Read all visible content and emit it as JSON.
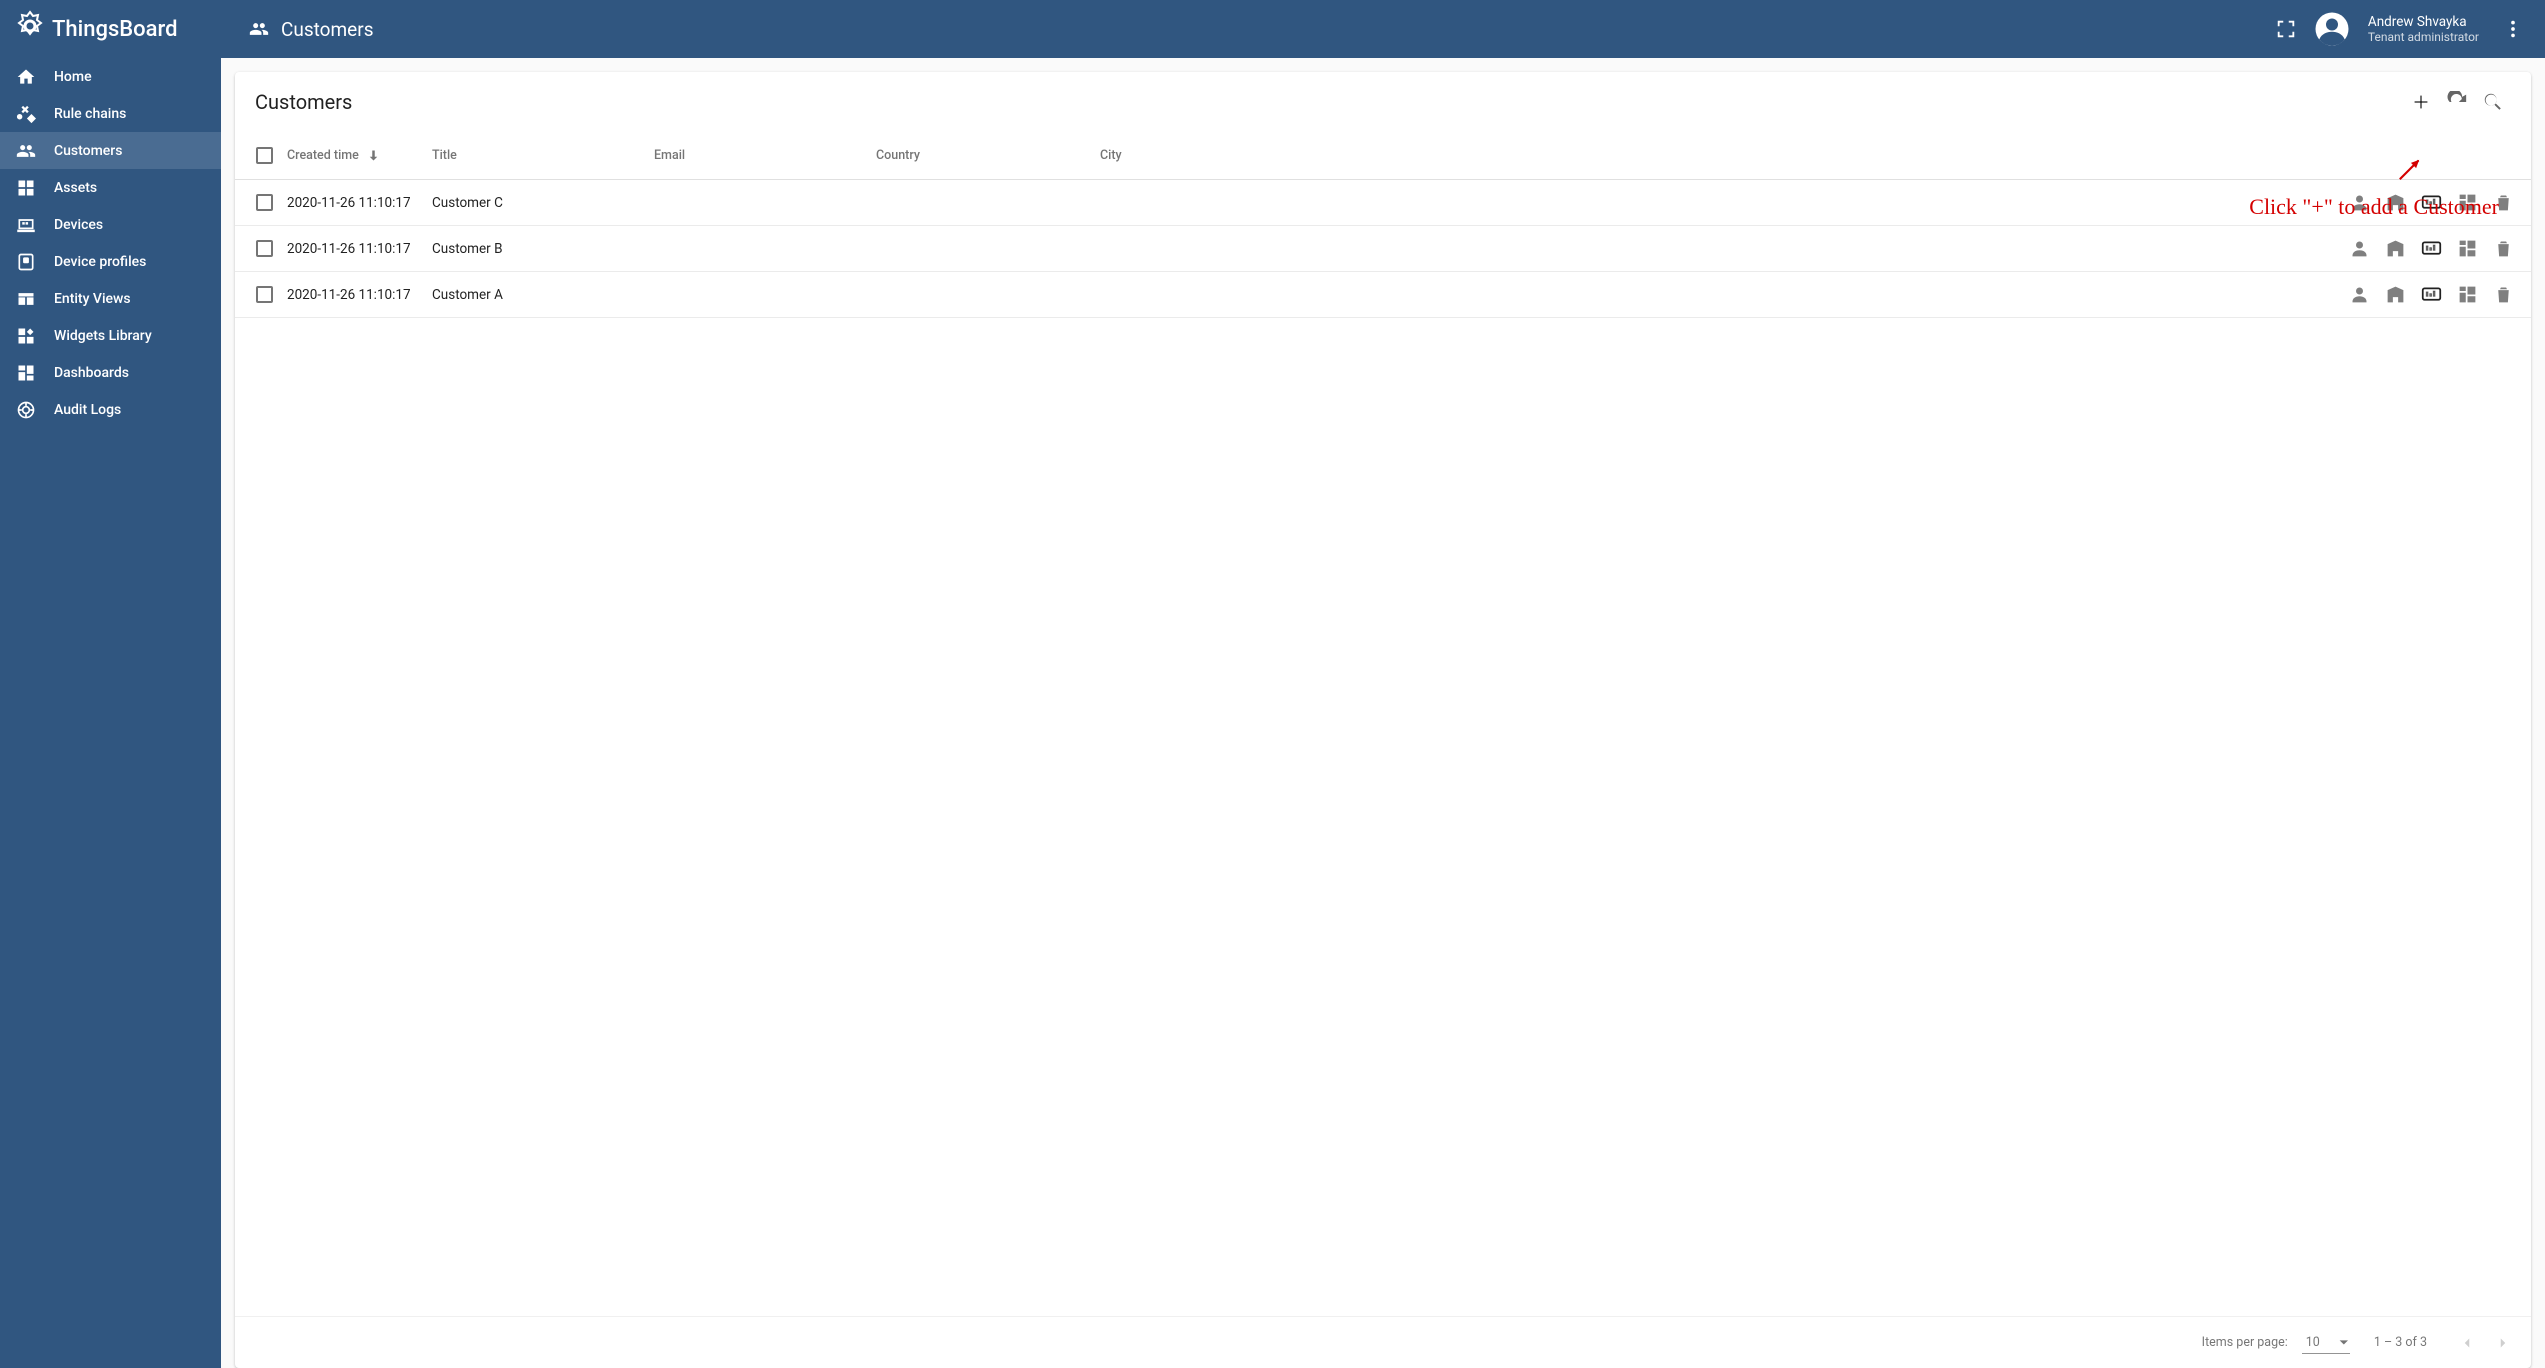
{
  "brand": {
    "name": "ThingsBoard"
  },
  "header": {
    "title": "Customers",
    "user_name": "Andrew Shvayka",
    "user_role": "Tenant administrator"
  },
  "sidebar": {
    "items": [
      {
        "label": "Home",
        "icon": "home-icon"
      },
      {
        "label": "Rule chains",
        "icon": "rule-chains-icon"
      },
      {
        "label": "Customers",
        "icon": "customers-icon",
        "active": true
      },
      {
        "label": "Assets",
        "icon": "assets-icon"
      },
      {
        "label": "Devices",
        "icon": "devices-icon"
      },
      {
        "label": "Device profiles",
        "icon": "device-profiles-icon"
      },
      {
        "label": "Entity Views",
        "icon": "entity-views-icon"
      },
      {
        "label": "Widgets Library",
        "icon": "widgets-library-icon"
      },
      {
        "label": "Dashboards",
        "icon": "dashboards-icon"
      },
      {
        "label": "Audit Logs",
        "icon": "audit-logs-icon"
      }
    ]
  },
  "card": {
    "title": "Customers",
    "callout": "Click \"+\" to add a Customer"
  },
  "table": {
    "columns": {
      "created": "Created time",
      "title": "Title",
      "email": "Email",
      "country": "Country",
      "city": "City"
    },
    "rows": [
      {
        "created": "2020-11-26 11:10:17",
        "title": "Customer C",
        "email": "",
        "country": "",
        "city": ""
      },
      {
        "created": "2020-11-26 11:10:17",
        "title": "Customer B",
        "email": "",
        "country": "",
        "city": ""
      },
      {
        "created": "2020-11-26 11:10:17",
        "title": "Customer A",
        "email": "",
        "country": "",
        "city": ""
      }
    ]
  },
  "paginator": {
    "items_per_page_label": "Items per page:",
    "page_size": "10",
    "range": "1 – 3 of 3"
  }
}
